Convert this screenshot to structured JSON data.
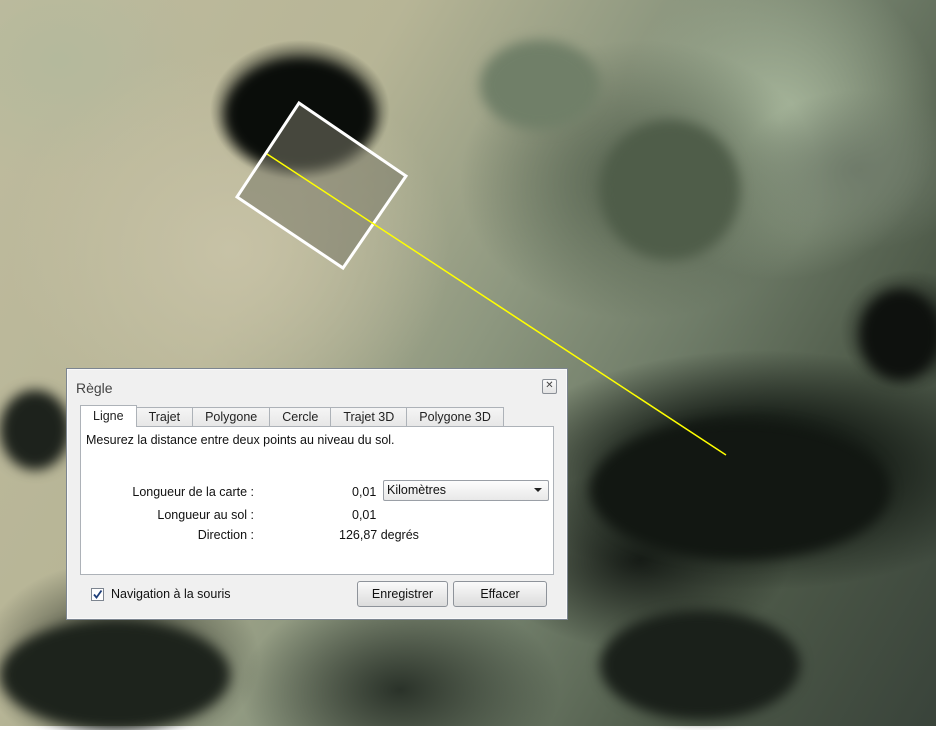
{
  "map": {
    "description_icon": "satellite-imagery"
  },
  "ruler": {
    "line_color": "#ffff00",
    "outline_color": "#ffffff"
  },
  "dialog": {
    "title": "Règle",
    "close_icon": "close-icon",
    "tabs": [
      "Ligne",
      "Trajet",
      "Polygone",
      "Cercle",
      "Trajet 3D",
      "Polygone 3D"
    ],
    "active_tab": "Ligne",
    "description": "Mesurez la distance entre deux points au niveau du sol.",
    "map_length_label": "Longueur de la carte :",
    "map_length_value": "0,01",
    "unit_selected": "Kilomètres",
    "ground_length_label": "Longueur au sol :",
    "ground_length_value": "0,01",
    "direction_label": "Direction :",
    "direction_value": "126,87 degrés",
    "mouse_nav_label": "Navigation à la souris",
    "mouse_nav_checked": true,
    "save_label": "Enregistrer",
    "clear_label": "Effacer"
  }
}
